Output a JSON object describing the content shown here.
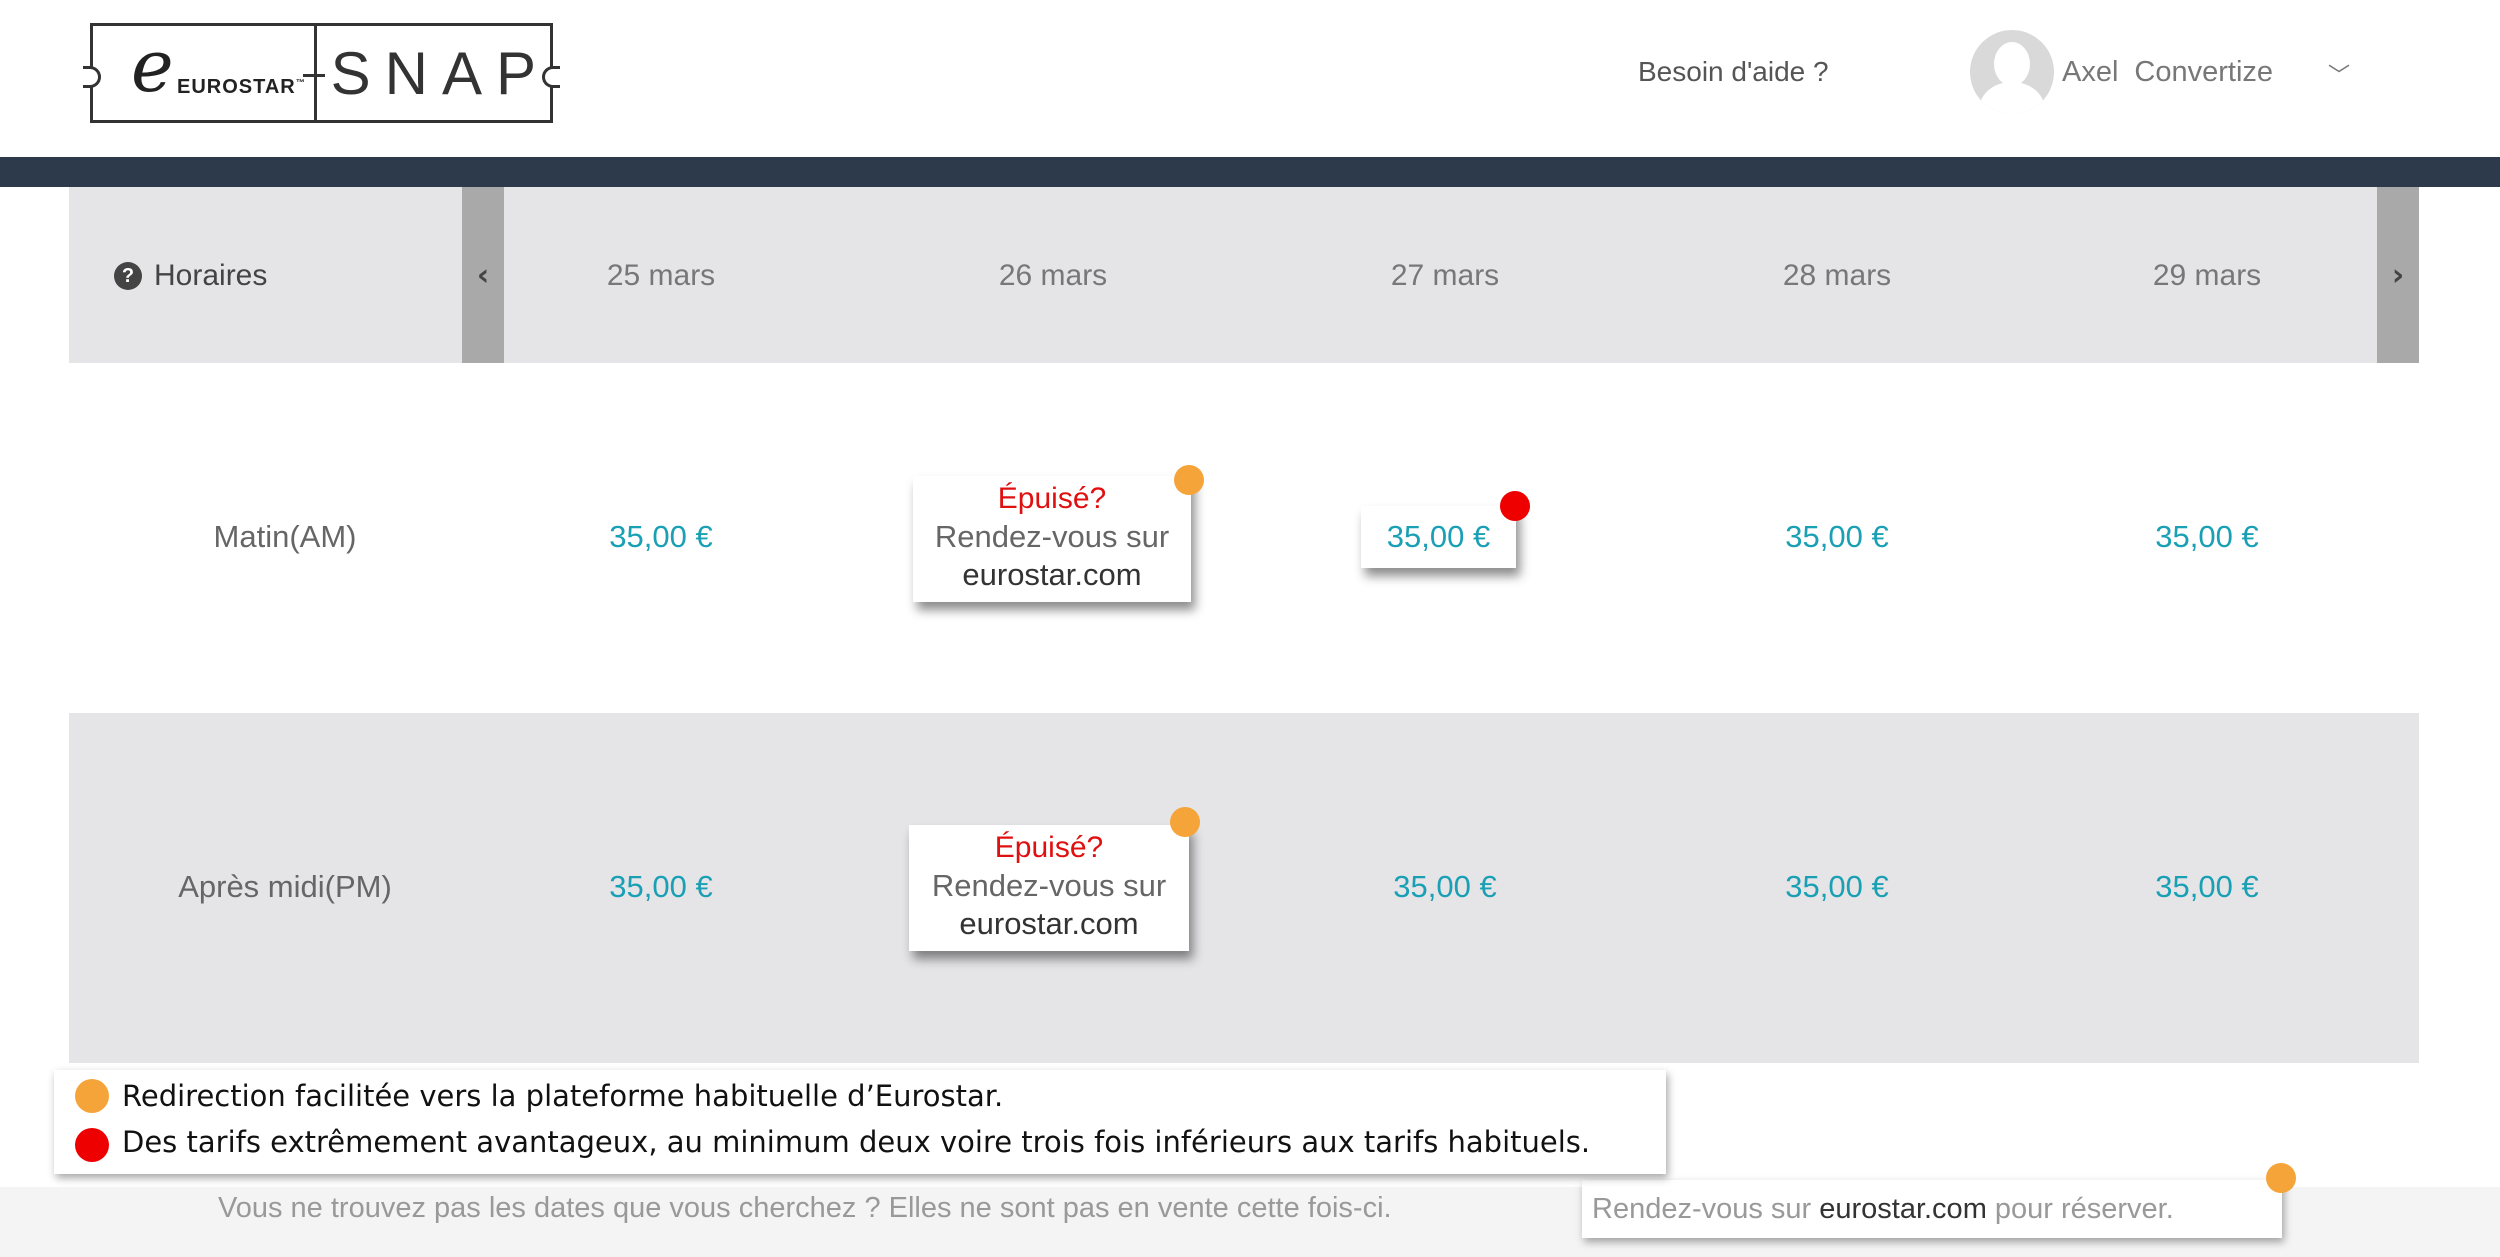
{
  "header": {
    "logo_brand": "EUROSTAR",
    "logo_product": "SNAP",
    "help_link": "Besoin d'aide ?",
    "user_first": "Axel",
    "user_last": "Convertize"
  },
  "grid": {
    "header_label": "Horaires",
    "dates": [
      "25 mars",
      "26 mars",
      "27 mars",
      "28 mars",
      "29 mars"
    ],
    "rows": [
      {
        "label": "Matin(AM)",
        "prices": [
          "35,00 €",
          "",
          "35,00 €",
          "35,00 €",
          "35,00 €"
        ]
      },
      {
        "label": "Après midi(PM)",
        "prices": [
          "35,00 €",
          "",
          "35,00 €",
          "35,00 €",
          "35,00 €"
        ]
      }
    ]
  },
  "sold_out": {
    "title": "Épuisé?",
    "line2": "Rendez-vous sur",
    "site": "eurostar.com"
  },
  "legend": {
    "orange_text": "Redirection facilitée vers la plateforme habituelle d’Eurostar.",
    "red_text": "Des tarifs extrêmement avantageux, au minimum deux voire trois fois inférieurs aux tarifs habituels."
  },
  "footer": {
    "text": "Vous ne trouvez pas les dates que vous cherchez ? Elles ne sont pas en vente cette fois-ci.",
    "box_pre": "Rendez-vous sur",
    "box_site": "eurostar.com",
    "box_post": "pour réserver."
  },
  "colors": {
    "price": "#1aa0b4",
    "sold_out": "#e01010",
    "navbar": "#2c3a4b",
    "orange_dot": "#f5a43a",
    "red_dot": "#ee0000"
  }
}
